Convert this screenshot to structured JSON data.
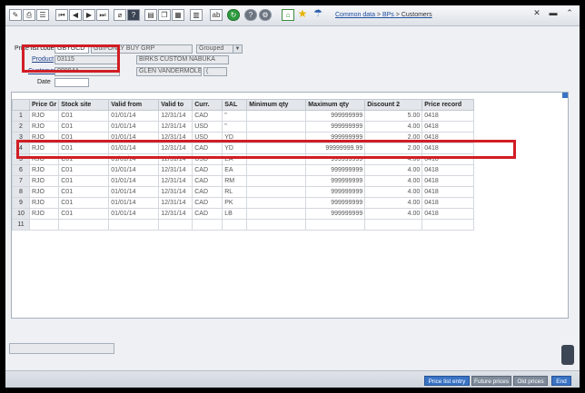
{
  "breadcrumb": {
    "item1": "Common data",
    "sep": ">",
    "item2": "BPs",
    "current": "Customers"
  },
  "form": {
    "price_list_code_label": "Price list code",
    "price_list_code": "GBYGCD",
    "price_list_desc": "Gun-ONLY BUY GRP",
    "grouped_value": "Grouped",
    "product_label": "Product",
    "product_code": "03115",
    "product_desc": "BIRKS CUSTOM NABUKA",
    "customer_label": "Customer",
    "customer_code": "000044",
    "customer_name": "GLEN VANDERMOLEN",
    "customer_extra": "(",
    "date_label": "Date"
  },
  "grid": {
    "columns": [
      "Price Gr",
      "Stock site",
      "Valid from",
      "Valid to",
      "Curr.",
      "SAL",
      "Minimum qty",
      "Maximum qty",
      "Discount 2",
      "Price record"
    ],
    "rows": [
      {
        "n": "1",
        "pg": "RJO",
        "site": "C01",
        "from": "01/01/14",
        "to": "12/31/14",
        "curr": "CAD",
        "sal": "\"",
        "min": "",
        "max": "999999999",
        "disc": "5.00",
        "rec": "0418"
      },
      {
        "n": "2",
        "pg": "RJO",
        "site": "C01",
        "from": "01/01/14",
        "to": "12/31/14",
        "curr": "USD",
        "sal": "\"",
        "min": "",
        "max": "999999999",
        "disc": "4.00",
        "rec": "0418"
      },
      {
        "n": "3",
        "pg": "RJO",
        "site": "C01",
        "from": "01/01/14",
        "to": "12/31/14",
        "curr": "USD",
        "sal": "YD",
        "min": "",
        "max": "999999999",
        "disc": "2.00",
        "rec": "0418"
      },
      {
        "n": "4",
        "pg": "RJO",
        "site": "C01",
        "from": "01/01/14",
        "to": "12/31/14",
        "curr": "CAD",
        "sal": "YD",
        "min": "",
        "max": "99999999.99",
        "disc": "2.00",
        "rec": "0418"
      },
      {
        "n": "5",
        "pg": "RJO",
        "site": "C01",
        "from": "01/01/14",
        "to": "12/31/14",
        "curr": "USD",
        "sal": "EA",
        "min": "",
        "max": "999999999",
        "disc": "4.00",
        "rec": "0418"
      },
      {
        "n": "6",
        "pg": "RJO",
        "site": "C01",
        "from": "01/01/14",
        "to": "12/31/14",
        "curr": "CAD",
        "sal": "EA",
        "min": "",
        "max": "999999999",
        "disc": "4.00",
        "rec": "0418"
      },
      {
        "n": "7",
        "pg": "RJO",
        "site": "C01",
        "from": "01/01/14",
        "to": "12/31/14",
        "curr": "CAD",
        "sal": "RM",
        "min": "",
        "max": "999999999",
        "disc": "4.00",
        "rec": "0418"
      },
      {
        "n": "8",
        "pg": "RJO",
        "site": "C01",
        "from": "01/01/14",
        "to": "12/31/14",
        "curr": "CAD",
        "sal": "RL",
        "min": "",
        "max": "999999999",
        "disc": "4.00",
        "rec": "0418"
      },
      {
        "n": "9",
        "pg": "RJO",
        "site": "C01",
        "from": "01/01/14",
        "to": "12/31/14",
        "curr": "CAD",
        "sal": "PK",
        "min": "",
        "max": "999999999",
        "disc": "4.00",
        "rec": "0418"
      },
      {
        "n": "10",
        "pg": "RJO",
        "site": "C01",
        "from": "01/01/14",
        "to": "12/31/14",
        "curr": "CAD",
        "sal": "LB",
        "min": "",
        "max": "999999999",
        "disc": "4.00",
        "rec": "0418"
      },
      {
        "n": "11",
        "pg": "",
        "site": "",
        "from": "",
        "to": "",
        "curr": "",
        "sal": "",
        "min": "",
        "max": "",
        "disc": "",
        "rec": ""
      }
    ]
  },
  "buttons": {
    "price_list_entry": "Price list entry",
    "future_prices": "Future prices",
    "old_prices": "Old prices",
    "end": "End"
  },
  "colors": {
    "highlight": "#d11d24",
    "accent": "#3a73c4"
  }
}
